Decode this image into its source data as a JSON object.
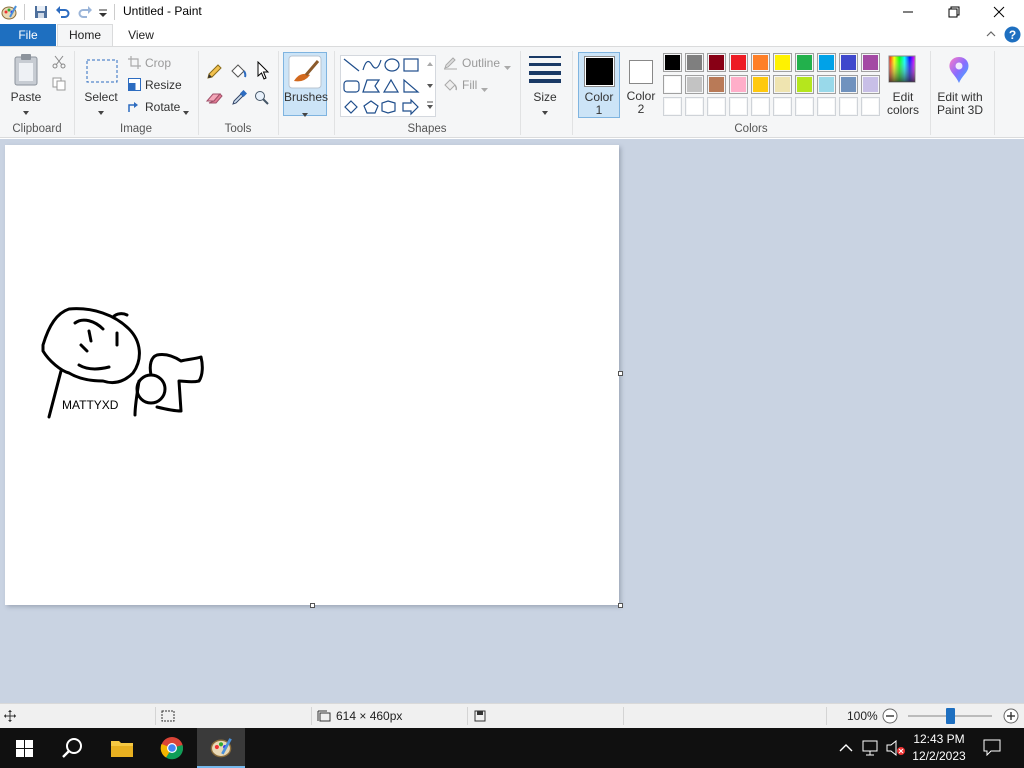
{
  "window": {
    "title": "Untitled - Paint"
  },
  "tabs": {
    "file": "File",
    "home": "Home",
    "view": "View"
  },
  "ribbon": {
    "clipboard": {
      "paste": "Paste",
      "group": "Clipboard"
    },
    "image": {
      "select": "Select",
      "crop": "Crop",
      "resize": "Resize",
      "rotate": "Rotate",
      "group": "Image"
    },
    "tools": {
      "group": "Tools"
    },
    "brushes": {
      "label": "Brushes"
    },
    "shapes": {
      "outline": "Outline",
      "fill": "Fill",
      "group": "Shapes"
    },
    "size": {
      "label": "Size"
    },
    "colors": {
      "color1_line1": "Color",
      "color1_line2": "1",
      "color2_line1": "Color",
      "color2_line2": "2",
      "edit_line1": "Edit",
      "edit_line2": "colors",
      "paint3d_line1": "Edit with",
      "paint3d_line2": "Paint 3D",
      "group": "Colors",
      "color1_value": "#000000",
      "color2_value": "#ffffff",
      "palette_row1": [
        "#000000",
        "#7f7f7f",
        "#880015",
        "#ed1c24",
        "#ff7f27",
        "#fff200",
        "#22b14c",
        "#00a2e8",
        "#3f48cc",
        "#a349a4"
      ],
      "palette_row2": [
        "#ffffff",
        "#c3c3c3",
        "#b97a57",
        "#ffaec9",
        "#ffc90e",
        "#efe4b0",
        "#b5e61d",
        "#99d9ea",
        "#7092be",
        "#c8bfe7"
      ],
      "palette_row3": [
        "#ffffff",
        "#ffffff",
        "#ffffff",
        "#ffffff",
        "#ffffff",
        "#ffffff",
        "#ffffff",
        "#ffffff",
        "#ffffff",
        "#ffffff"
      ]
    }
  },
  "canvas": {
    "drawing_text": "MATTYXD"
  },
  "statusbar": {
    "dimensions": "614 × 460px",
    "zoom": "100%"
  },
  "taskbar": {
    "time": "12:43 PM",
    "date": "12/2/2023"
  }
}
